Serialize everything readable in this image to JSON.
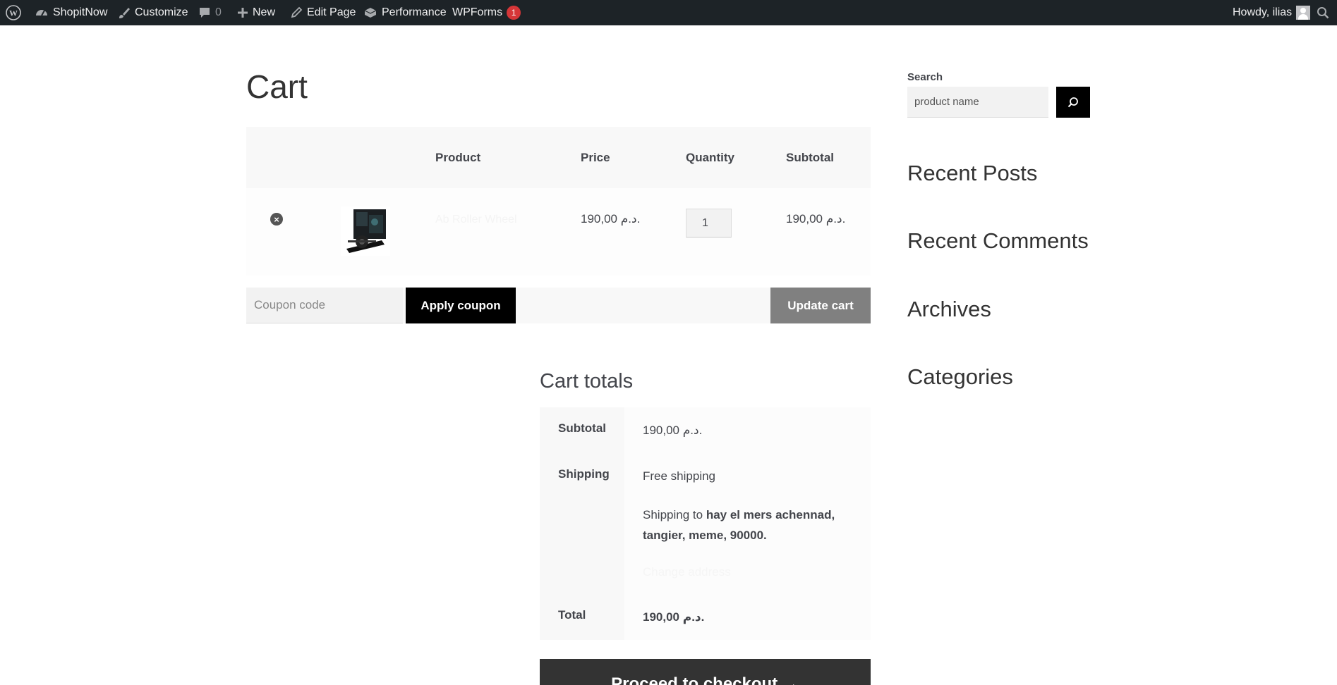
{
  "admin_bar": {
    "site_name": "ShopitNow",
    "customize": "Customize",
    "comments_count": "0",
    "new": "New",
    "edit_page": "Edit Page",
    "performance": "Performance",
    "wpforms": "WPForms",
    "wpforms_badge": "1",
    "howdy": "Howdy, ilias"
  },
  "page": {
    "title": "Cart"
  },
  "cart_table": {
    "headers": {
      "product": "Product",
      "price": "Price",
      "quantity": "Quantity",
      "subtotal": "Subtotal"
    },
    "rows": [
      {
        "remove": "×",
        "product_name": "Ab Roller Wheel",
        "price": "190,00 د.م.",
        "quantity": "1",
        "subtotal": "190,00 د.م."
      }
    ]
  },
  "actions": {
    "coupon_placeholder": "Coupon code",
    "apply_coupon": "Apply coupon",
    "update_cart": "Update cart"
  },
  "cart_totals": {
    "title": "Cart totals",
    "subtotal_label": "Subtotal",
    "subtotal_value": "190,00 د.م.",
    "shipping_label": "Shipping",
    "shipping_method": "Free shipping",
    "shipping_to_prefix": "Shipping to",
    "shipping_address_line1": "hay el mers achennad,",
    "shipping_address_line2": "tangier, meme, 90000.",
    "change_address": "Change address",
    "total_label": "Total",
    "total_value": "190,00 د.م."
  },
  "checkout": {
    "label": "Proceed to checkout →"
  },
  "sidebar": {
    "search_label": "Search",
    "search_placeholder": "product name",
    "widgets": [
      "Recent Posts",
      "Recent Comments",
      "Archives",
      "Categories"
    ]
  }
}
